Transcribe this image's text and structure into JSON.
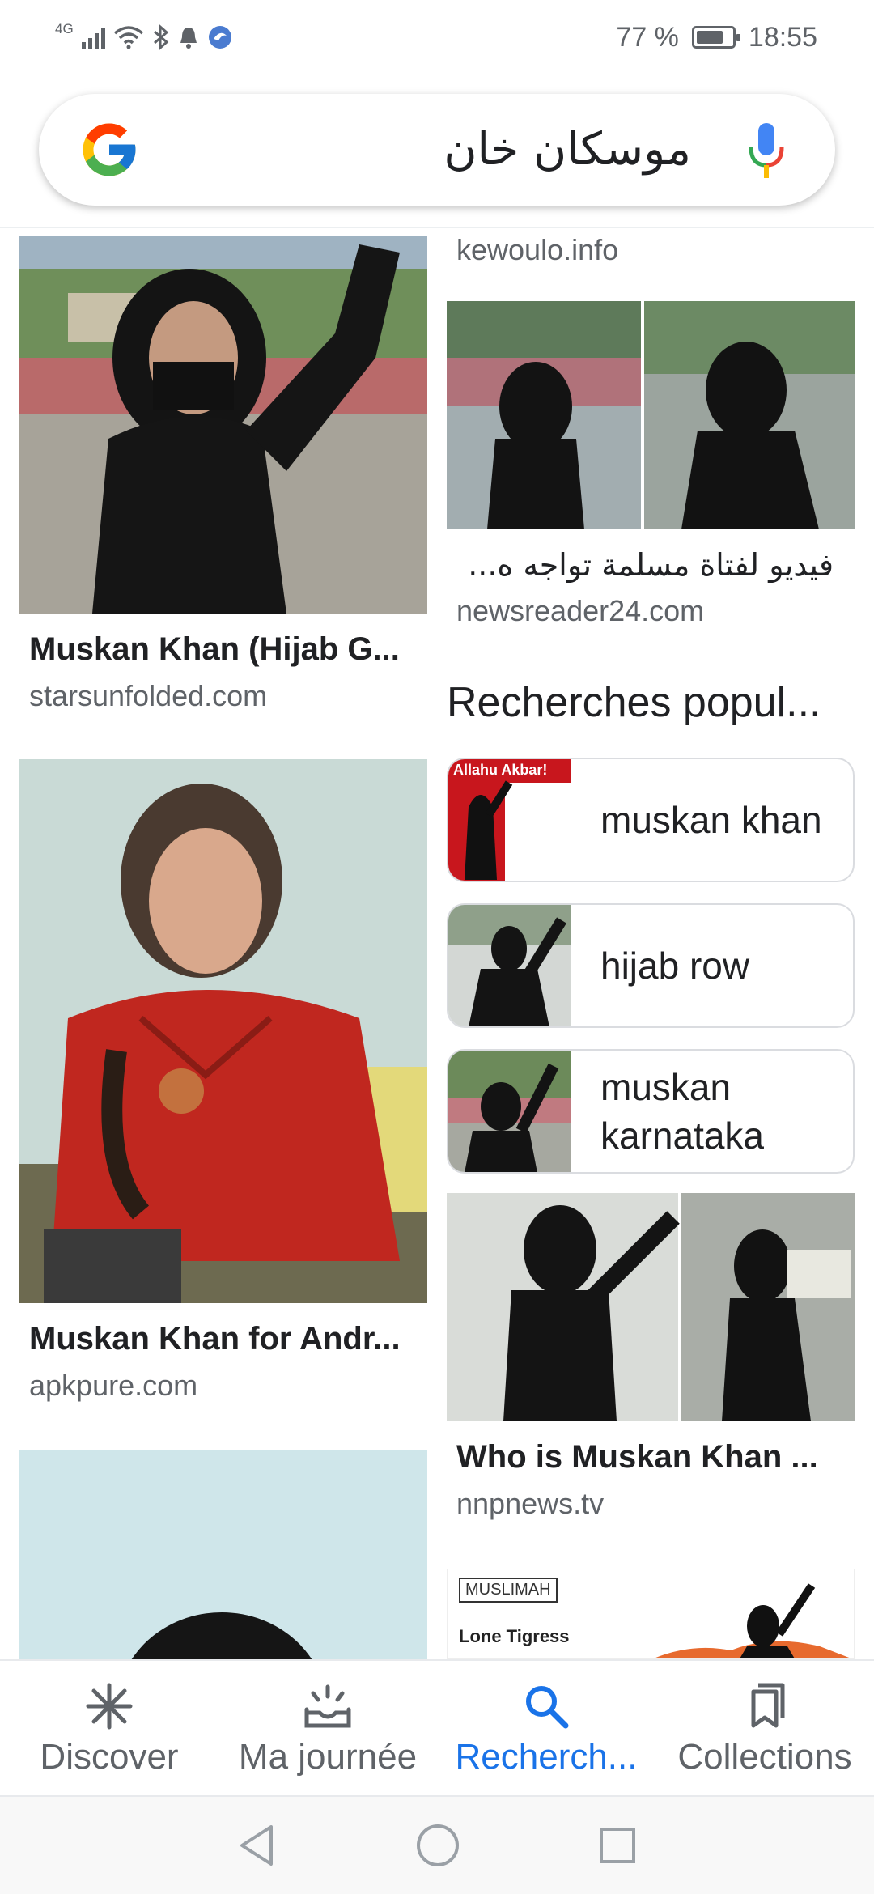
{
  "status_bar": {
    "network": "4G",
    "battery_percent": "77 %",
    "battery_level": 0.77,
    "time": "18:55"
  },
  "search": {
    "query": "موسكان خان"
  },
  "results_left": [
    {
      "title": "Muskan Khan (Hijab G...",
      "source": "starsunfolded.com"
    },
    {
      "title": "Muskan Khan for Andr...",
      "source": "apkpure.com"
    }
  ],
  "results_right": {
    "top_source": "kewoulo.info",
    "item1": {
      "title": "فيديو لفتاة مسلمة تواجه ه...",
      "source": "newsreader24.com"
    },
    "popular": {
      "heading": "Recherches popul...",
      "items": [
        {
          "label": "muskan khan",
          "thumb_text": "Allahu Akbar!"
        },
        {
          "label": "hijab row"
        },
        {
          "label": "muskan karnataka"
        }
      ]
    },
    "item2": {
      "title": "Who is Muskan Khan ...",
      "source": "nnpnews.tv"
    },
    "item3": {
      "thumb_text_1": "MUSLIMAH",
      "thumb_text_2": "Lone Tigress"
    }
  },
  "bottom_nav": [
    {
      "label": "Discover",
      "icon": "asterisk-icon"
    },
    {
      "label": "Ma journée",
      "icon": "inbox-sun-icon"
    },
    {
      "label": "Recherch...",
      "icon": "search-icon"
    },
    {
      "label": "Collections",
      "icon": "bookmarks-icon"
    }
  ],
  "colors": {
    "active": "#1a73e8",
    "muted": "#5f6368",
    "text": "#202124"
  }
}
